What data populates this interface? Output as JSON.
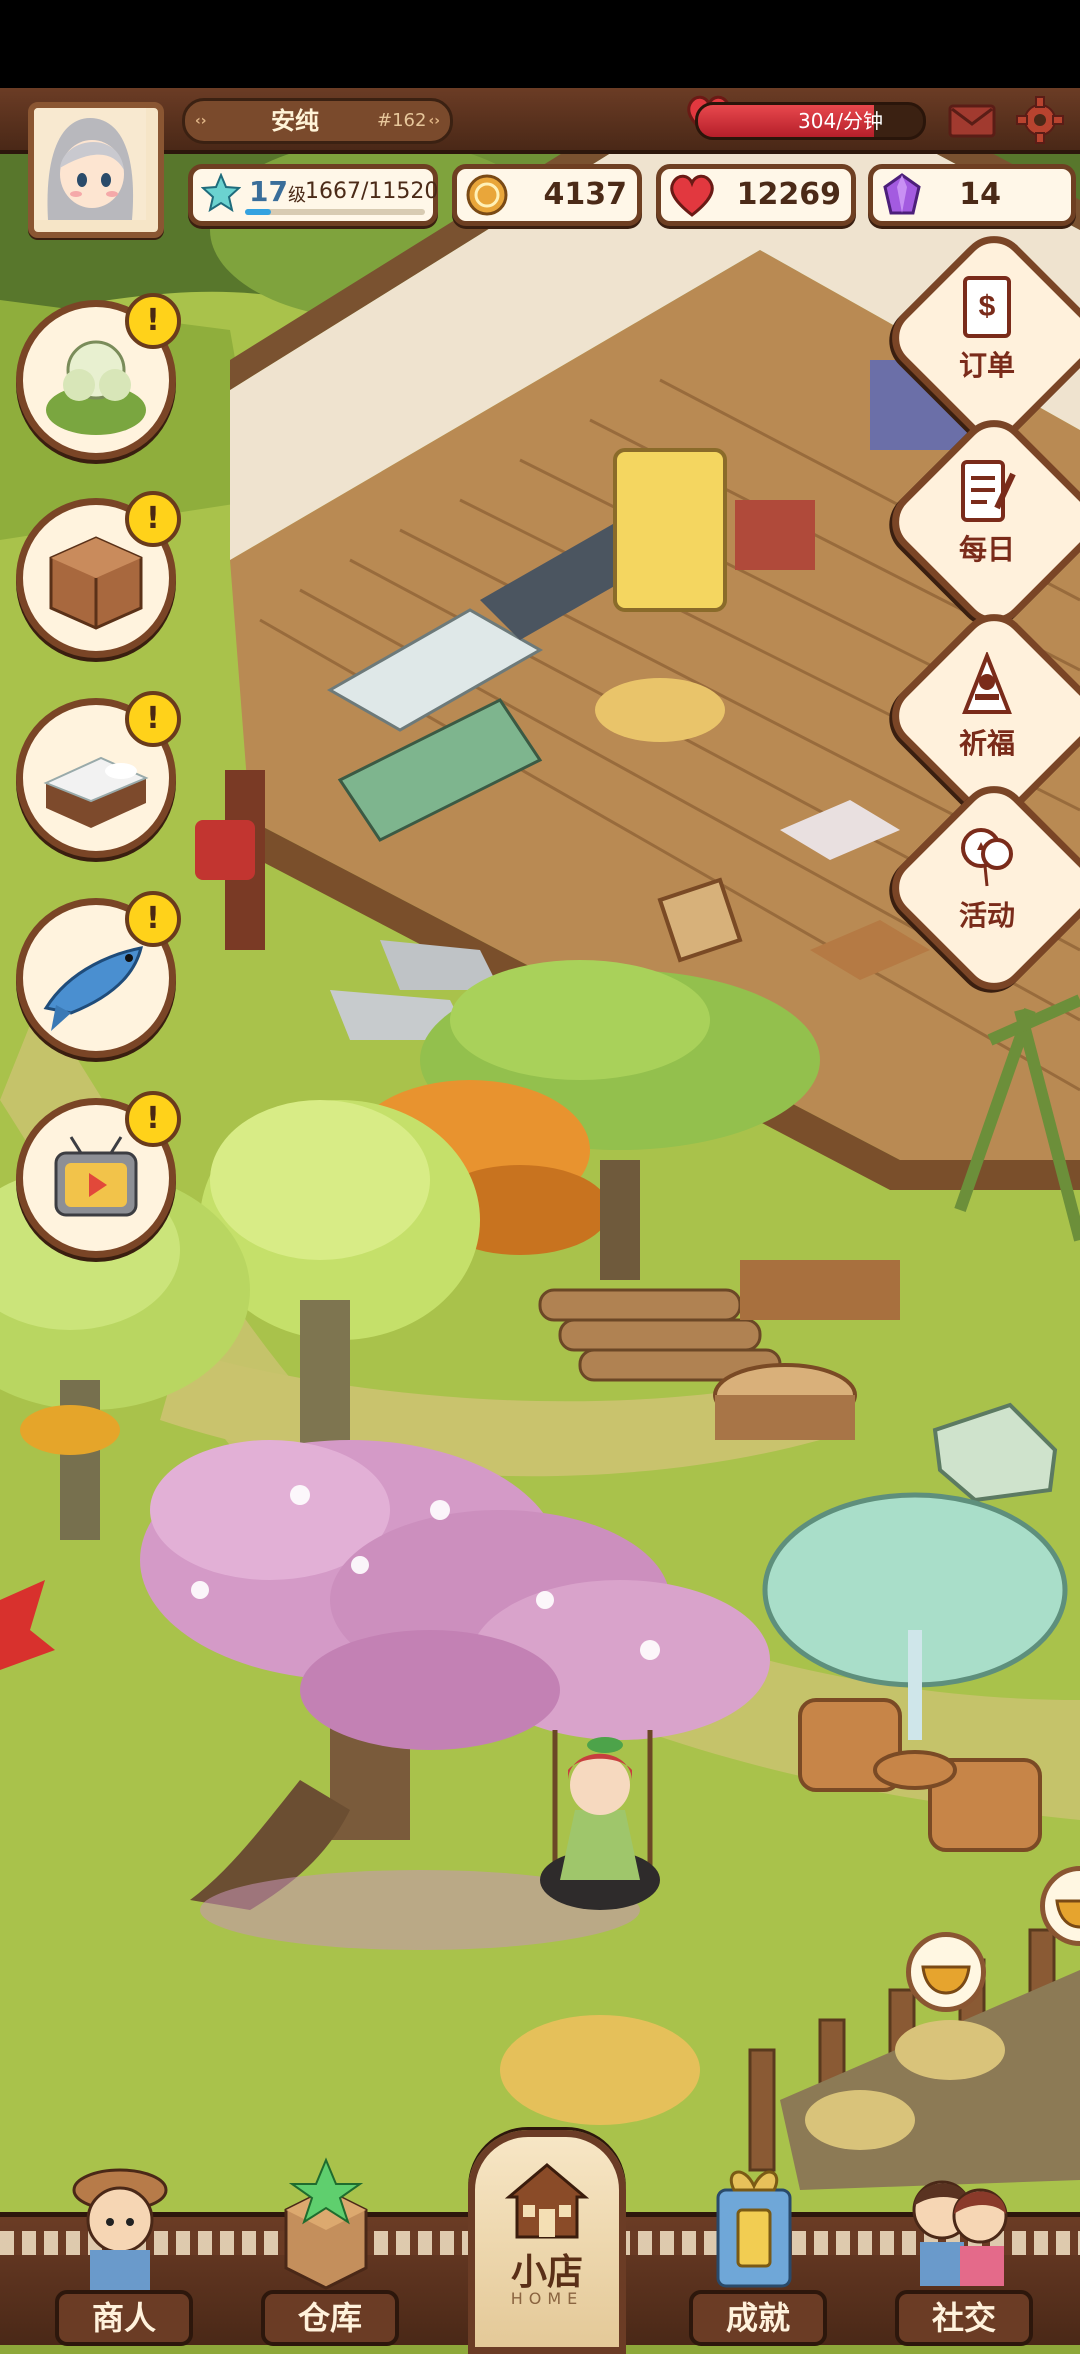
{
  "player": {
    "name": "安纯",
    "id": "#162",
    "level": "17",
    "level_unit": "级",
    "xp_text": "1667/11520",
    "xp_fraction": 0.145
  },
  "energy": {
    "text": "304/分钟",
    "fill_fraction": 0.78
  },
  "resources": {
    "coins": "4137",
    "hearts": "12269",
    "gems": "14"
  },
  "tasks": [
    {
      "icon": "cabbage-plant-icon",
      "badge": "!"
    },
    {
      "icon": "wooden-cabinet-icon",
      "badge": "!"
    },
    {
      "icon": "bed-icon",
      "badge": "!"
    },
    {
      "icon": "fish-icon",
      "badge": "!"
    },
    {
      "icon": "tv-ad-icon",
      "badge": "!"
    }
  ],
  "right_menu": [
    {
      "label": "订单",
      "icon": "order-book-icon"
    },
    {
      "label": "每日",
      "icon": "daily-checklist-icon"
    },
    {
      "label": "祈福",
      "icon": "prayer-icon"
    },
    {
      "label": "活动",
      "icon": "event-balloon-icon"
    }
  ],
  "bottom_nav": {
    "merchant": "商人",
    "warehouse": "仓库",
    "shop": "小店",
    "shop_sub": "HOME",
    "achievement": "成就",
    "social": "社交"
  },
  "colors": {
    "hud_brown": "#6b3c25",
    "hud_dark": "#2d170c",
    "panel_cream": "#fff7e8",
    "badge_yellow": "#ffd21a",
    "hp_red": "#d8313a",
    "xp_blue": "#34a2e0",
    "grass": "#a6c04a"
  }
}
